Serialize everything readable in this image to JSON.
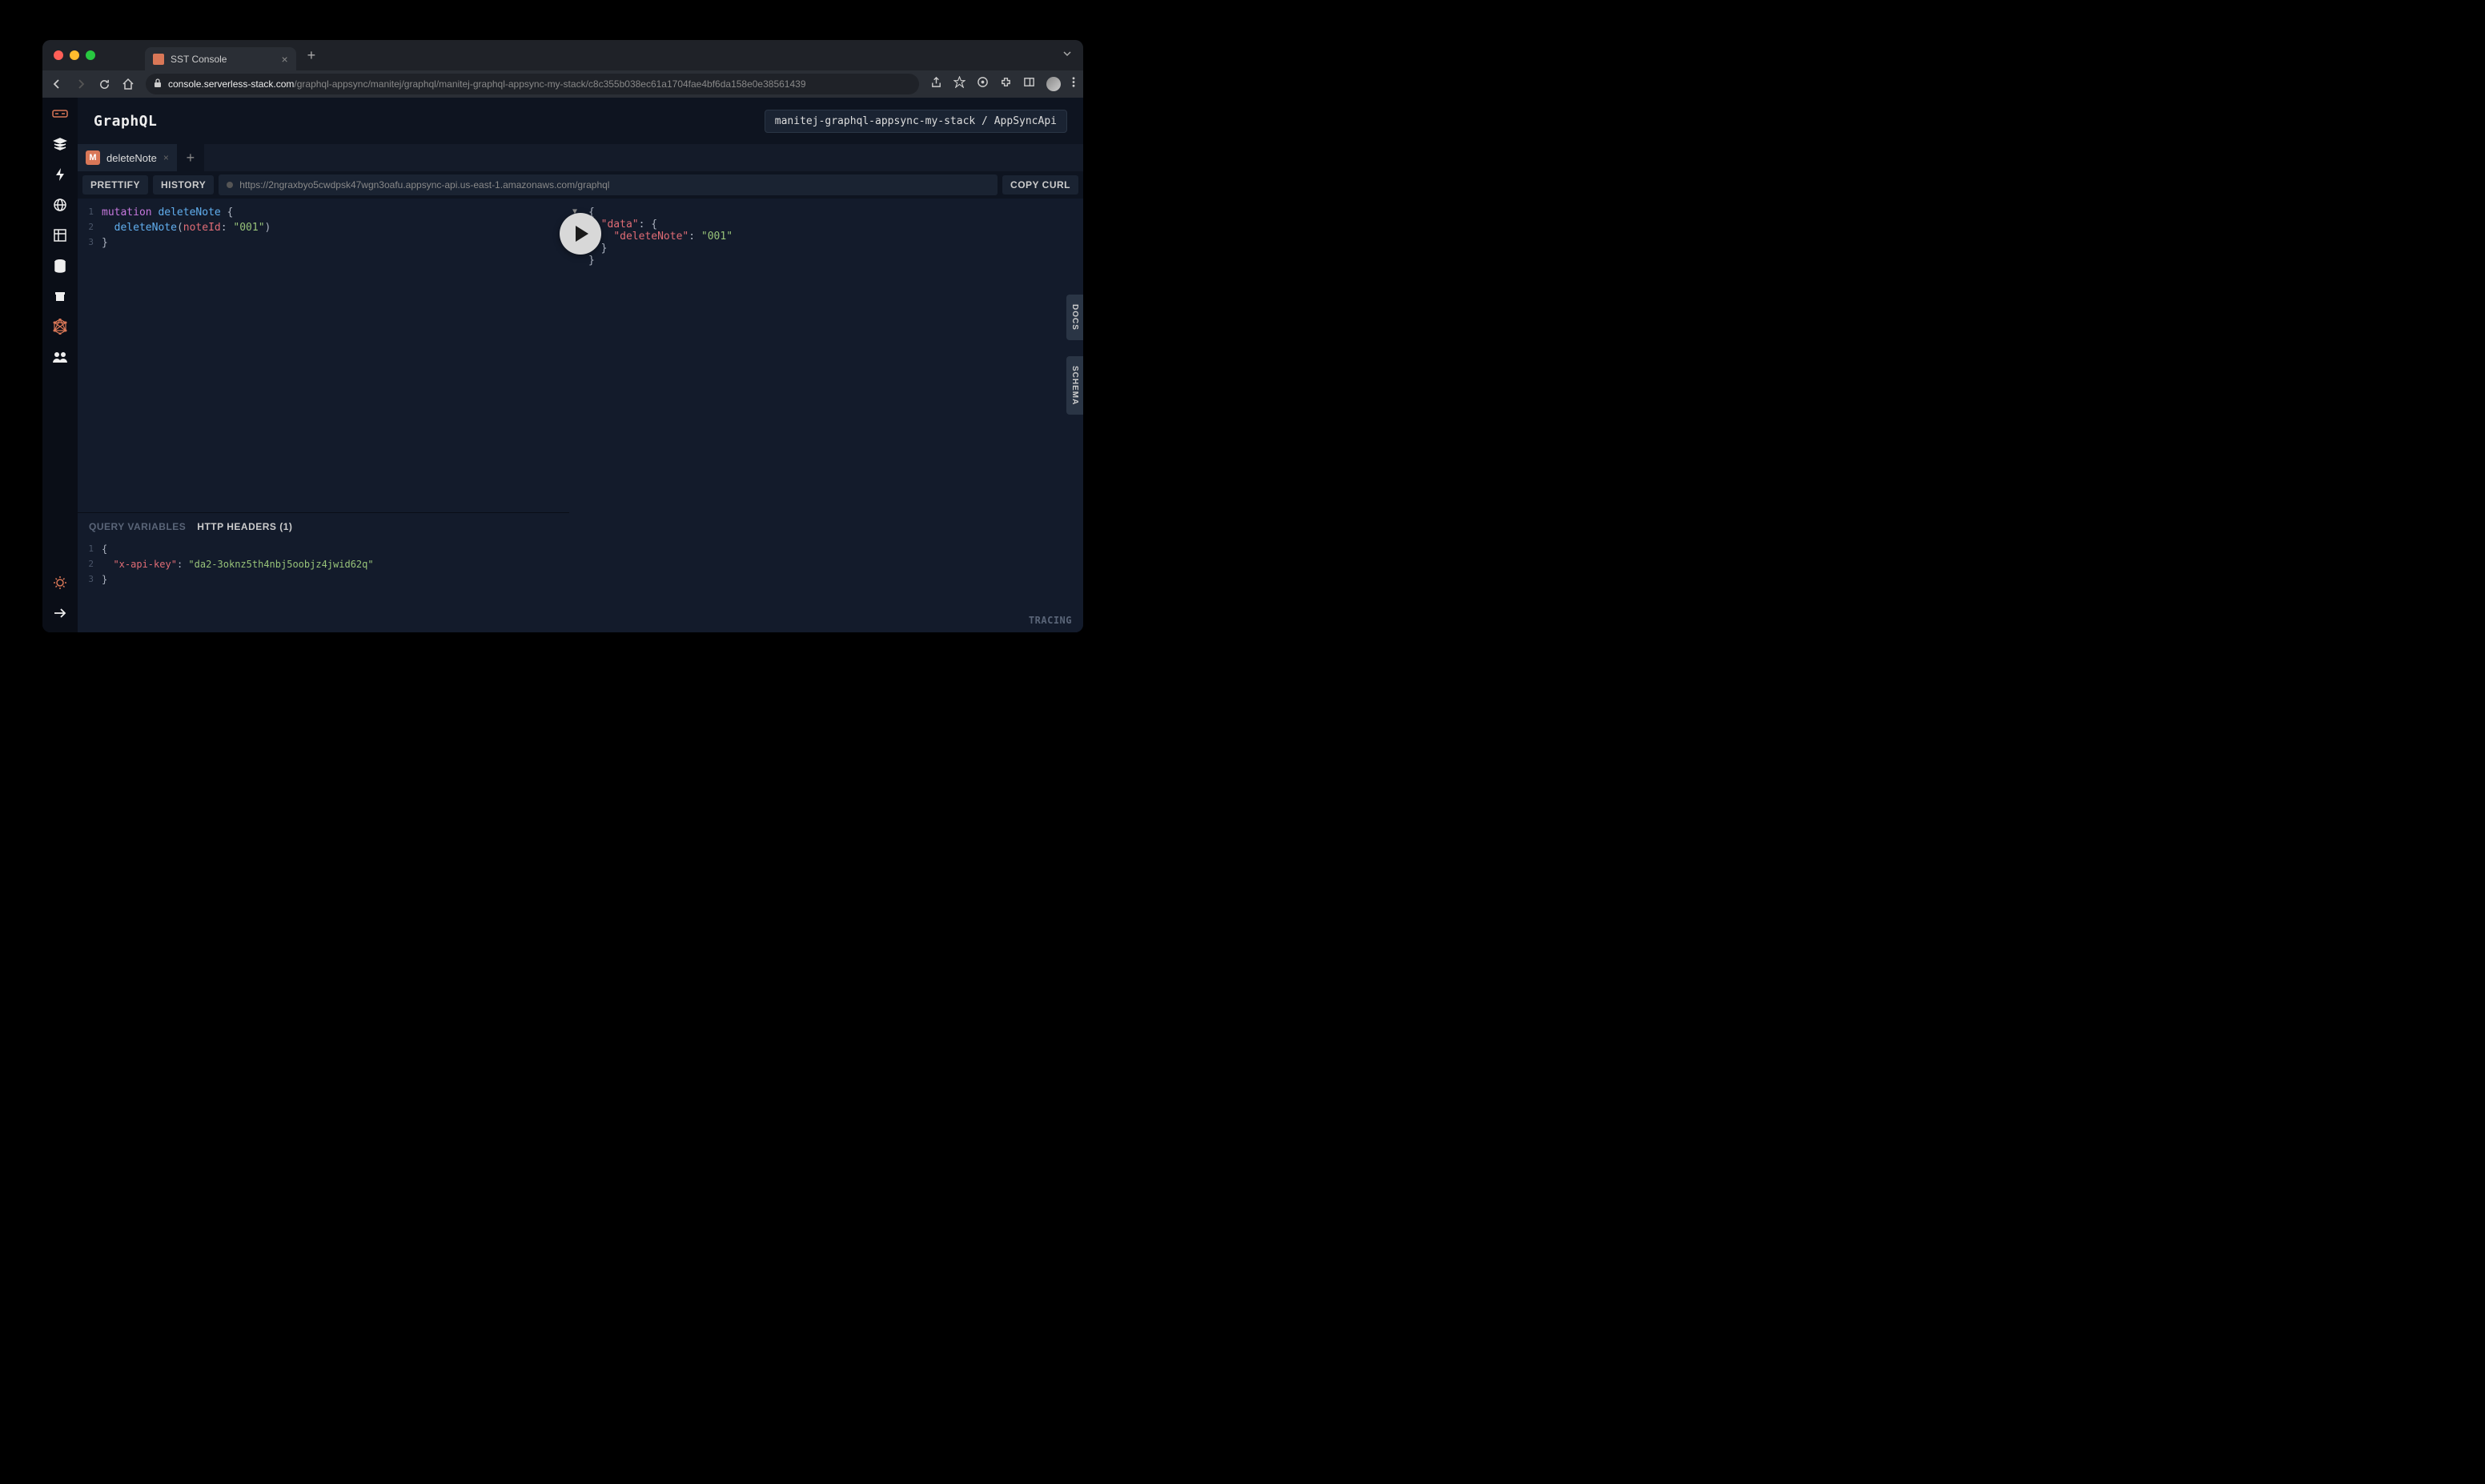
{
  "browser": {
    "tab_title": "SST Console",
    "url_domain": "console.serverless-stack.com",
    "url_path": "/graphql-appsync/manitej/graphql/manitej-graphql-appsync-my-stack/c8c355b038ec61a1704fae4bf6da158e0e38561439"
  },
  "header": {
    "title": "GraphQL",
    "breadcrumb_stack": "manitej-graphql-appsync-my-stack",
    "breadcrumb_api": "AppSyncApi"
  },
  "tabs": {
    "active_badge": "M",
    "active_name": "deleteNote"
  },
  "toolbar": {
    "prettify": "PRETTIFY",
    "history": "HISTORY",
    "endpoint": "https://2ngraxbyo5cwdpsk47wgn3oafu.appsync-api.us-east-1.amazonaws.com/graphql",
    "copy_curl": "COPY CURL"
  },
  "query_editor": {
    "lines": [
      {
        "kw": "mutation",
        "name": "deleteNote",
        "suffix": " {"
      },
      {
        "indent": "  ",
        "fn": "deleteNote",
        "arg_open": "(",
        "arg_name": "noteId",
        "colon": ": ",
        "arg_val": "\"001\"",
        "arg_close": ")"
      },
      {
        "text": "}"
      }
    ]
  },
  "variables_panel": {
    "tab_query_vars": "QUERY VARIABLES",
    "tab_http_headers": "HTTP HEADERS (1)",
    "headers_json": {
      "x-api-key": "da2-3oknz5th4nbj5oobjz4jwid62q"
    }
  },
  "result": {
    "data": {
      "deleteNote": "001"
    }
  },
  "side_tabs": {
    "docs": "DOCS",
    "schema": "SCHEMA"
  },
  "footer": {
    "tracing": "TRACING"
  }
}
